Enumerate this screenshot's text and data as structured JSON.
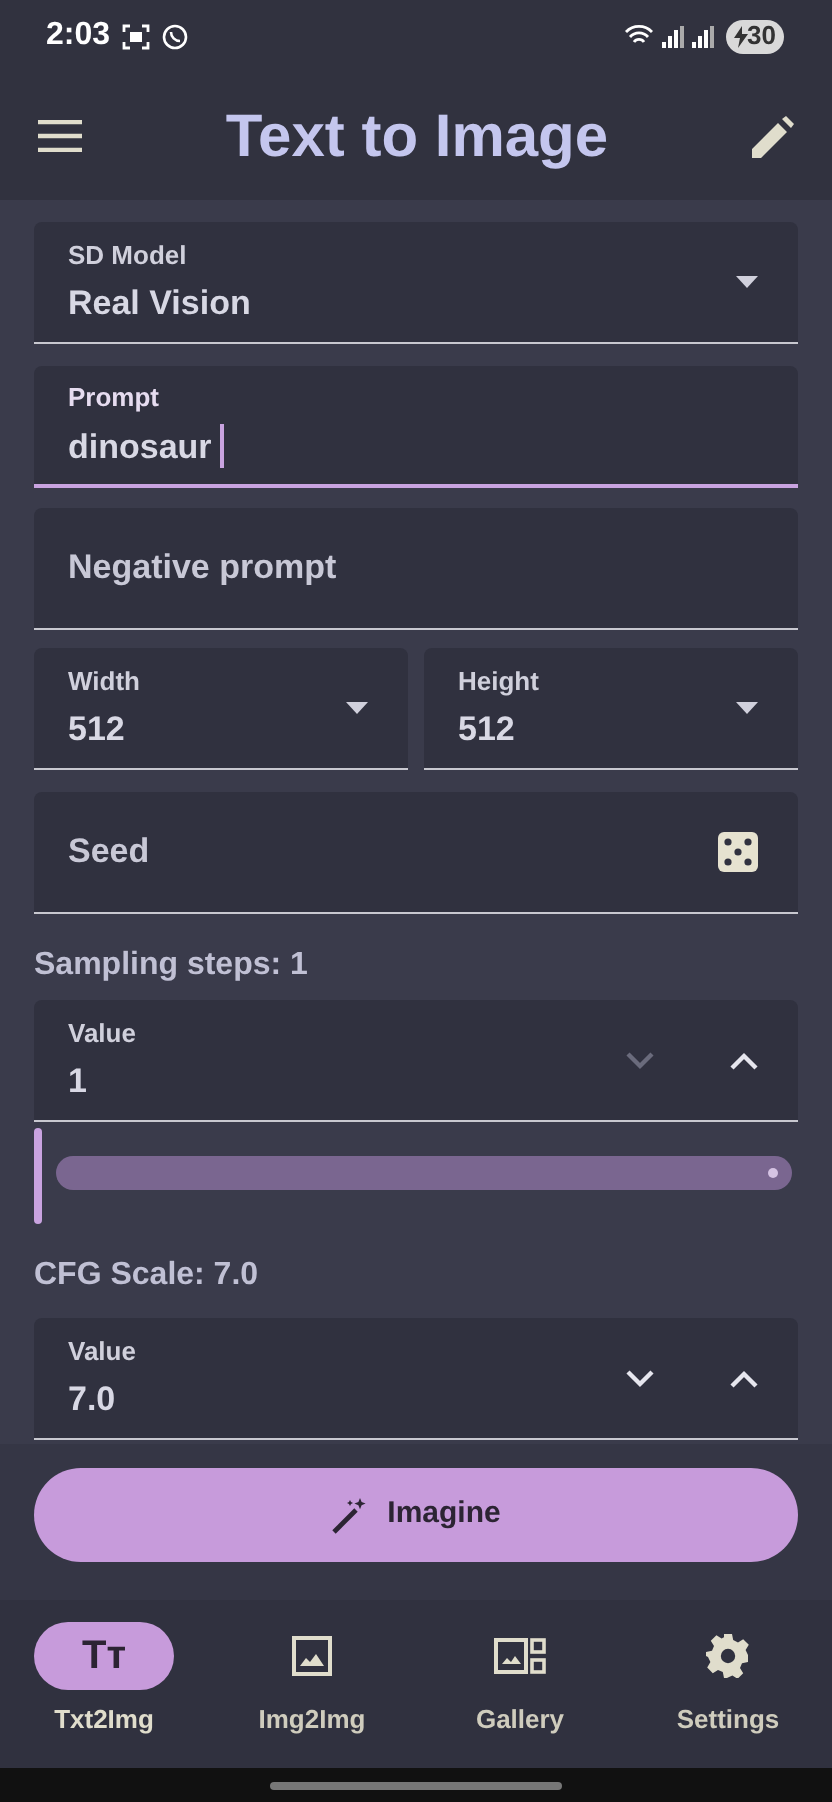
{
  "status_bar": {
    "time": "2:03",
    "battery": "30"
  },
  "app_bar": {
    "title": "Text to Image"
  },
  "sd_model": {
    "label": "SD Model",
    "value": "Real Vision"
  },
  "prompt": {
    "label": "Prompt",
    "value": "dinosaur",
    "focused": true
  },
  "negative_prompt": {
    "placeholder": "Negative prompt"
  },
  "width": {
    "label": "Width",
    "value": "512"
  },
  "height": {
    "label": "Height",
    "value": "512"
  },
  "seed": {
    "placeholder": "Seed"
  },
  "sampling_steps": {
    "heading": "Sampling steps: 1",
    "label": "Value",
    "value": "1",
    "decrement_disabled": true,
    "level": 0
  },
  "cfg_scale": {
    "heading": "CFG Scale: 7.0",
    "label": "Value",
    "value": "7.0",
    "decrement_disabled": false
  },
  "imagine_button": {
    "label": "Imagine"
  },
  "nav": [
    {
      "kind": "text",
      "glyph": "Tт",
      "label": "Txt2Img",
      "selected": true
    },
    {
      "kind": "image",
      "label": "Img2Img",
      "selected": false
    },
    {
      "kind": "gallery",
      "label": "Gallery",
      "selected": false
    },
    {
      "kind": "settings",
      "label": "Settings",
      "selected": false
    }
  ]
}
